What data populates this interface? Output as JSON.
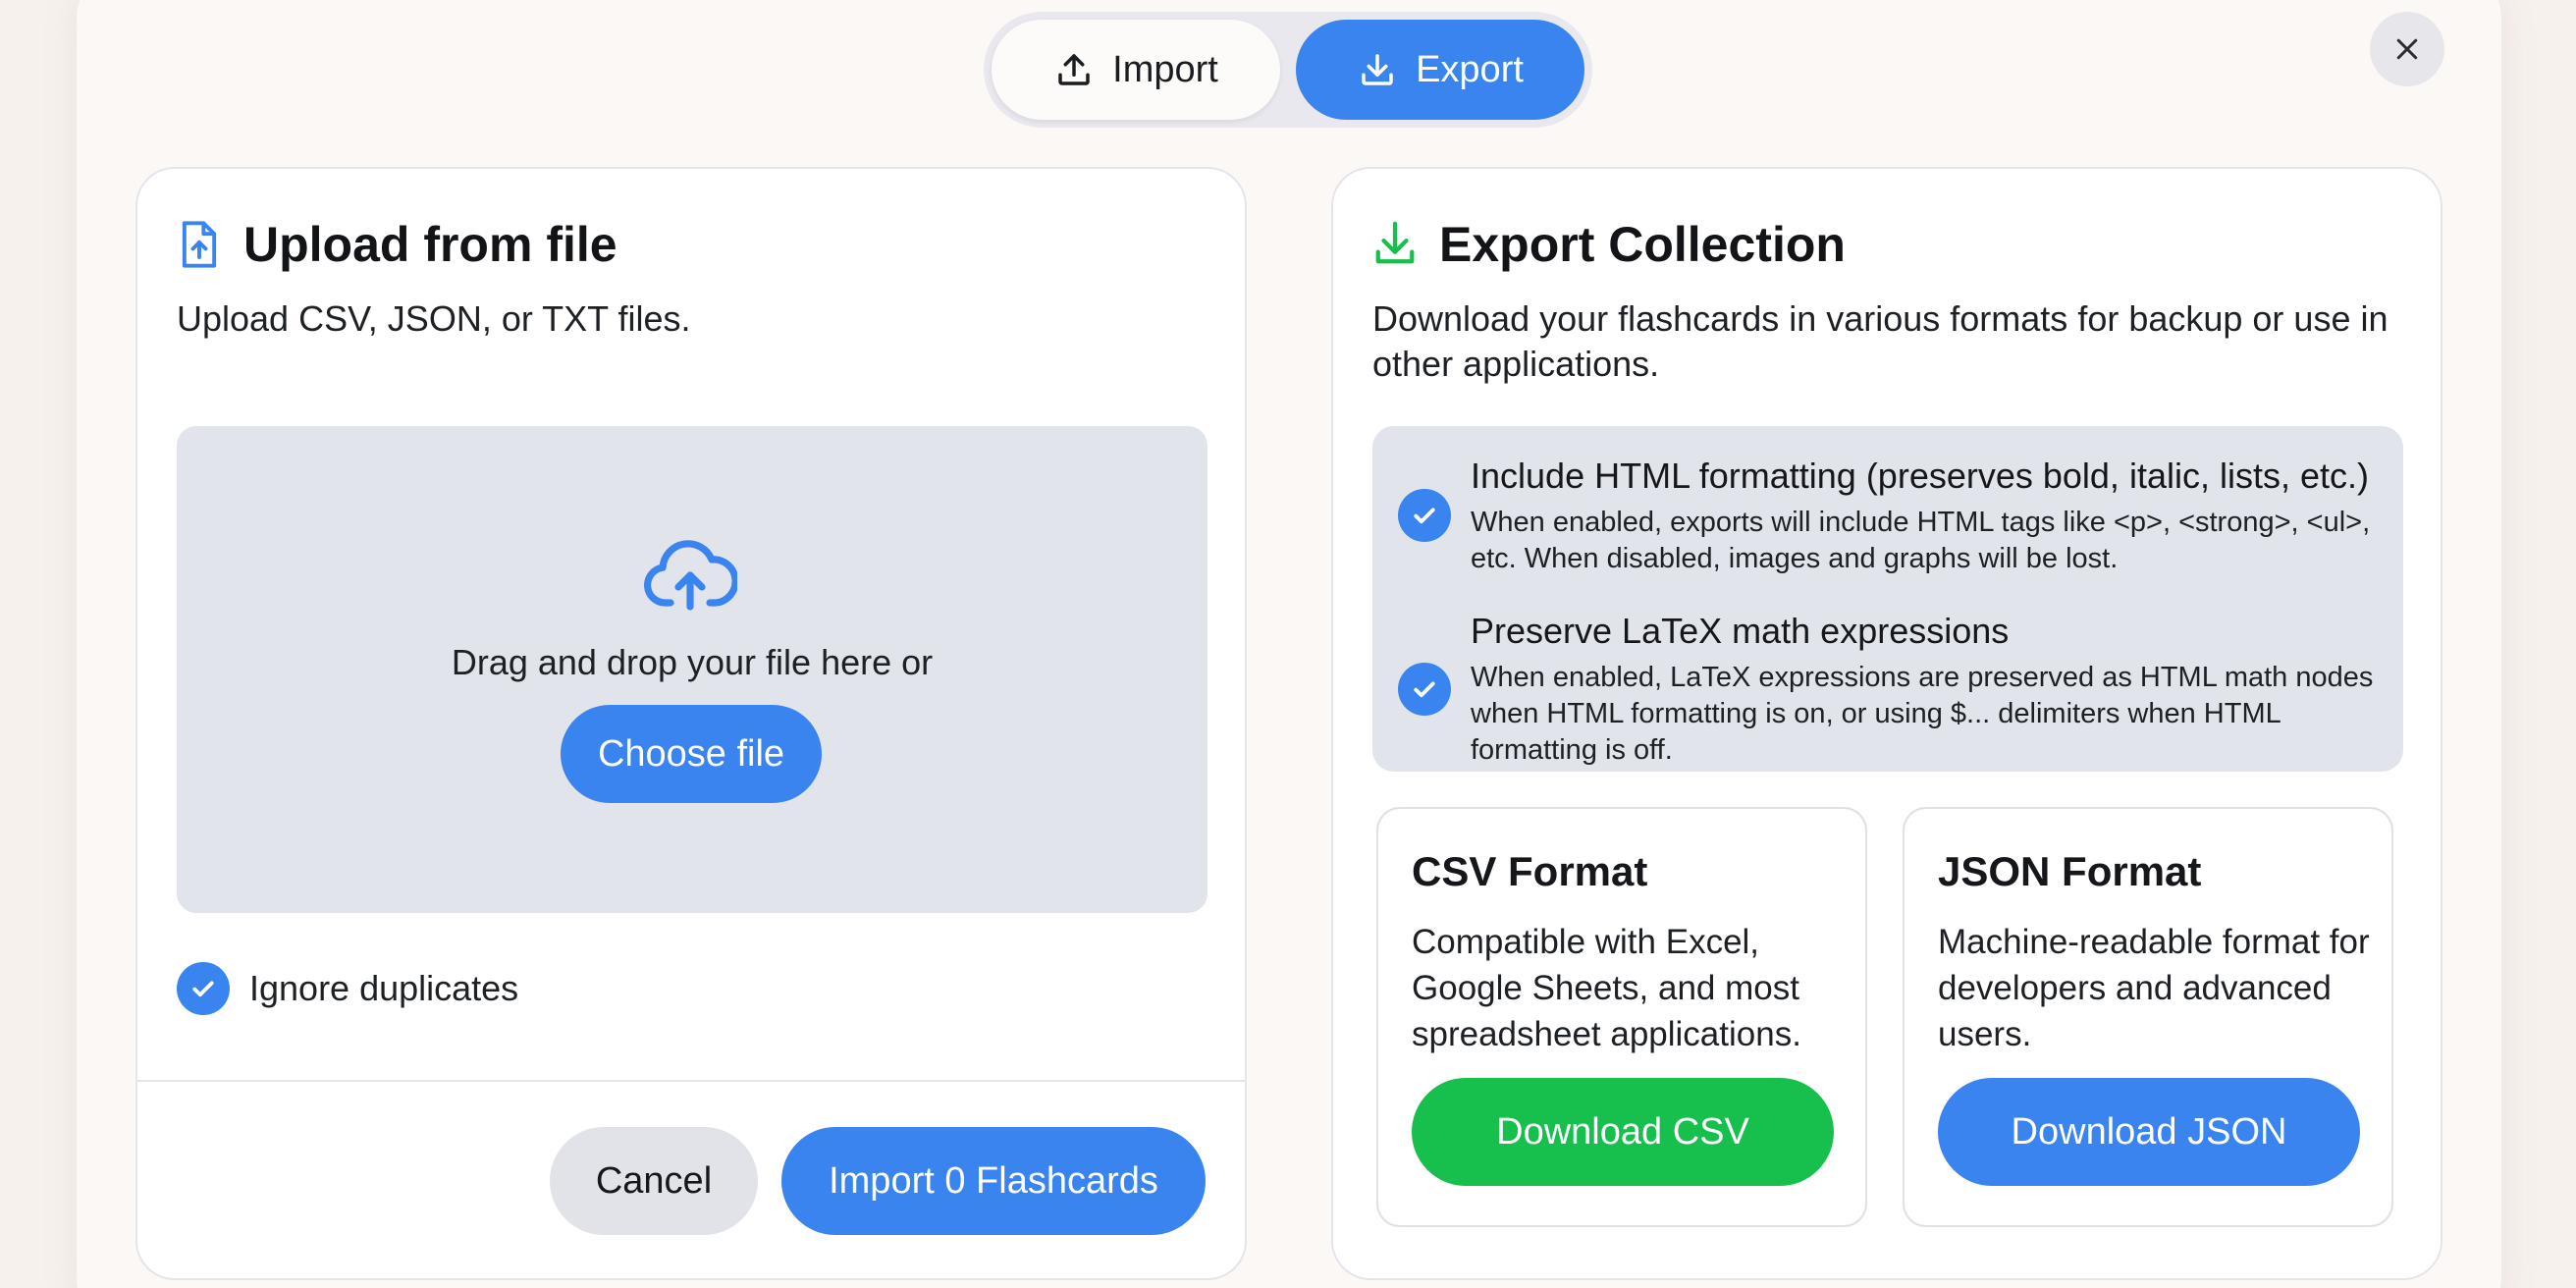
{
  "tabs": {
    "import_label": "Import",
    "export_label": "Export",
    "active": "export"
  },
  "import_card": {
    "title": "Upload from file",
    "description": "Upload CSV, JSON, or TXT files.",
    "dropzone_text": "Drag and drop your file here or",
    "choose_file_label": "Choose file",
    "ignore_duplicates_label": "Ignore duplicates",
    "ignore_duplicates_checked": true,
    "cancel_label": "Cancel",
    "import_label": "Import 0 Flashcards"
  },
  "export_card": {
    "title": "Export Collection",
    "description": "Download your flashcards in various formats for backup or use in other applications.",
    "options": [
      {
        "title": "Include HTML formatting (preserves bold, italic, lists, etc.)",
        "subtitle": "When enabled, exports will include HTML tags like <p>, <strong>, <ul>, etc. When disabled, images and graphs will be lost.",
        "checked": true
      },
      {
        "title": "Preserve LaTeX math expressions",
        "subtitle": "When enabled, LaTeX expressions are preserved as HTML math nodes when HTML formatting is on, or using $... delimiters when HTML formatting is off.",
        "checked": true
      }
    ],
    "csv": {
      "title": "CSV Format",
      "description": "Compatible with Excel, Google Sheets, and most spreadsheet applications.",
      "button_label": "Download CSV"
    },
    "json": {
      "title": "JSON Format",
      "description": "Machine-readable format for developers and advanced users.",
      "button_label": "Download JSON"
    }
  },
  "icons": {
    "import_tab": "upload-icon",
    "export_tab": "download-icon",
    "close": "close-icon",
    "upload_file": "file-upload-icon",
    "cloud_upload": "cloud-upload-icon",
    "export_title": "download-icon",
    "check": "check-icon"
  },
  "colors": {
    "accent": "#3a84ef",
    "success": "#17bf4c",
    "panel": "#e1e4ea",
    "background": "#f7f1ee"
  }
}
